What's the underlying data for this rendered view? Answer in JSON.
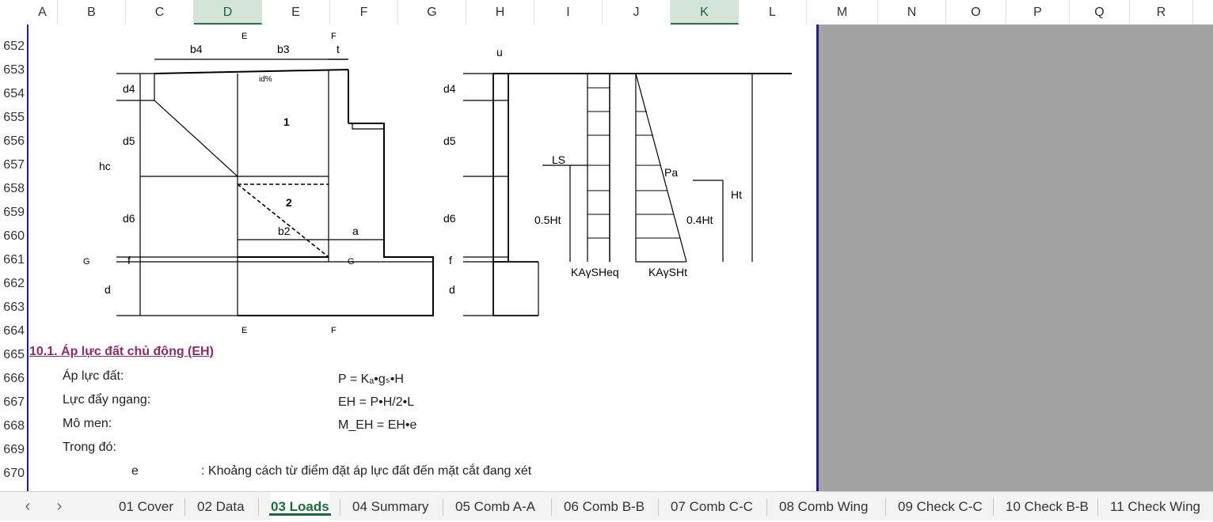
{
  "columns": [
    {
      "label": "A",
      "sel": false
    },
    {
      "label": "B",
      "sel": false
    },
    {
      "label": "C",
      "sel": false
    },
    {
      "label": "D",
      "sel": true
    },
    {
      "label": "E",
      "sel": false
    },
    {
      "label": "F",
      "sel": false
    },
    {
      "label": "G",
      "sel": false
    },
    {
      "label": "H",
      "sel": false
    },
    {
      "label": "I",
      "sel": false
    },
    {
      "label": "J",
      "sel": false
    },
    {
      "label": "K",
      "sel": true
    },
    {
      "label": "L",
      "sel": false
    },
    {
      "label": "M",
      "sel": false
    },
    {
      "label": "N",
      "sel": false
    },
    {
      "label": "O",
      "sel": false
    },
    {
      "label": "P",
      "sel": false
    },
    {
      "label": "Q",
      "sel": false
    },
    {
      "label": "R",
      "sel": false
    }
  ],
  "rows": [
    "652",
    "653",
    "654",
    "655",
    "656",
    "657",
    "658",
    "659",
    "660",
    "661",
    "662",
    "663",
    "664",
    "665",
    "666",
    "667",
    "668",
    "669",
    "670"
  ],
  "sheet": {
    "section_title": "10.1. Áp lực đất chủ động (EH)",
    "line1_label": "Áp lực đất:",
    "line1_formula": "P = Kₐ•gₛ•H",
    "line2_label": "Lực đẩy ngang:",
    "line2_formula": "EH = P•H/2•L",
    "line3_label": "Mô men:",
    "line3_formula": "M_EH = EH•e",
    "line4_label": "Trong đó:",
    "line5_symbol": "e",
    "line5_desc": ": Khoảng cách từ điểm đặt áp lực đất đến mặt cắt đang xét"
  },
  "diagram": {
    "b4": "b4",
    "b3": "b3",
    "t": "t",
    "u": "u",
    "d4": "d4",
    "d5": "d5",
    "d6": "d6",
    "hc": "hc",
    "f": "f",
    "d": "d",
    "id": "id%",
    "n1": "1",
    "n2": "2",
    "b2": "b2",
    "a": "a",
    "G": "G",
    "E": "E",
    "F": "F",
    "LS": "LS",
    "Pa": "Pa",
    "Ht": "Ht",
    "half": "0.5Ht",
    "zero4": "0.4Ht",
    "kheq": "KAγSHeq",
    "kht": "KAγSHt"
  },
  "tabs": [
    "01 Cover",
    "02 Data",
    "03 Loads",
    "04 Summary",
    "05 Comb A-A",
    "06 Comb B-B",
    "07 Comb C-C",
    "08 Comb Wing",
    "09 Check C-C",
    "10 Check B-B",
    "11 Check Wing"
  ],
  "active_tab": "03 Loads"
}
